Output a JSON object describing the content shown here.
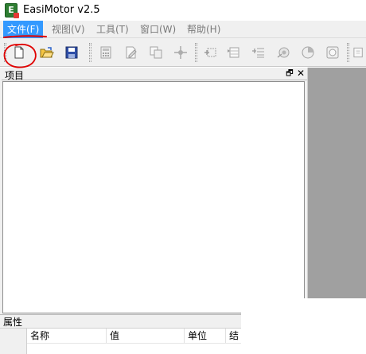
{
  "window": {
    "title": "EasiMotor v2.5",
    "app_icon_letter": "E"
  },
  "menubar": {
    "items": [
      {
        "label": "文件(F)",
        "active": true
      },
      {
        "label": "视图(V)",
        "active": false
      },
      {
        "label": "工具(T)",
        "active": false
      },
      {
        "label": "窗口(W)",
        "active": false
      },
      {
        "label": "帮助(H)",
        "active": false
      }
    ]
  },
  "toolbar": {
    "buttons": [
      {
        "icon": "new-document-icon",
        "enabled": true
      },
      {
        "icon": "open-folder-icon",
        "enabled": true
      },
      {
        "icon": "save-disk-icon",
        "enabled": true
      },
      {
        "icon": "calculator-icon",
        "enabled": false
      },
      {
        "icon": "edit-document-icon",
        "enabled": false
      },
      {
        "icon": "copy-icon",
        "enabled": false
      },
      {
        "icon": "crosshair-icon",
        "enabled": false
      },
      {
        "icon": "grid-add-icon",
        "enabled": false
      },
      {
        "icon": "table-insert-icon",
        "enabled": false
      },
      {
        "icon": "list-insert-icon",
        "enabled": false
      },
      {
        "icon": "rotor-icon",
        "enabled": false
      },
      {
        "icon": "pie-chart-icon",
        "enabled": false
      },
      {
        "icon": "stator-icon",
        "enabled": false
      },
      {
        "icon": "export-icon",
        "enabled": false
      }
    ]
  },
  "project_panel": {
    "title": "项目",
    "pin_glyph": "🗗",
    "close_glyph": "✕"
  },
  "properties_panel": {
    "title": "属性",
    "columns": [
      "名称",
      "值",
      "单位",
      "结"
    ]
  },
  "colors": {
    "menu_active_bg": "#3399ff",
    "workspace_gray": "#a0a0a0",
    "annotation_red": "#e00000"
  }
}
